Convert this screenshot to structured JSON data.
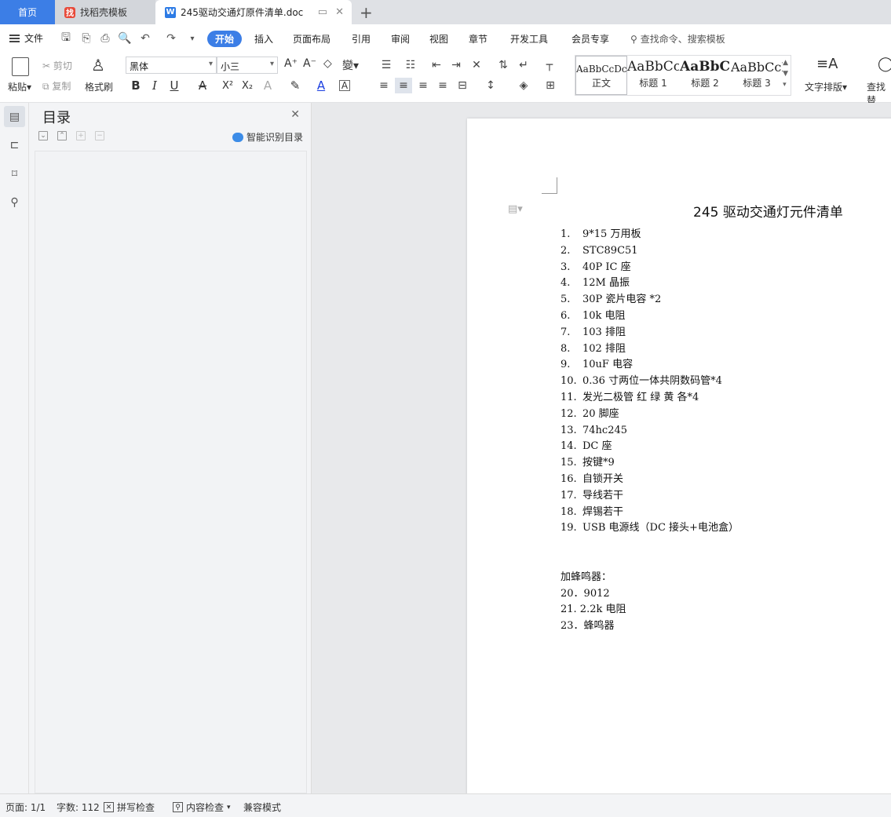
{
  "tabs": {
    "home": "首页",
    "templates": "找稻壳模板",
    "document": "245驱动交通灯原件清单.doc"
  },
  "menu": {
    "file": "文件",
    "items": [
      "开始",
      "插入",
      "页面布局",
      "引用",
      "审阅",
      "视图",
      "章节",
      "开发工具",
      "会员专享"
    ],
    "search_placeholder": "查找命令、搜索模板"
  },
  "ribbon": {
    "paste": "粘贴",
    "cut": "剪切",
    "copy": "复制",
    "format_painter": "格式刷",
    "font_name": "黑体",
    "font_size": "小三",
    "styles": [
      {
        "preview": "AaBbCcDc",
        "label": "正文"
      },
      {
        "preview": "AaBbCc",
        "label": "标题 1"
      },
      {
        "preview": "AaBbC",
        "label": "标题 2"
      },
      {
        "preview": "AaBbCcI",
        "label": "标题 3"
      }
    ],
    "text_layout": "文字排版",
    "find_replace": "查找替"
  },
  "toc": {
    "title": "目录",
    "smart_label": "智能识别目录"
  },
  "document": {
    "title": "245 驱动交通灯元件清单",
    "items": [
      {
        "num": "1.",
        "text": "9*15 万用板"
      },
      {
        "num": "2.",
        "text": "STC89C51"
      },
      {
        "num": "3.",
        "text": "40P IC 座"
      },
      {
        "num": "4.",
        "text": "12M 晶振"
      },
      {
        "num": "5.",
        "text": "30P 瓷片电容 *2"
      },
      {
        "num": "6.",
        "text": "10k 电阻"
      },
      {
        "num": "7.",
        "text": "103 排阻"
      },
      {
        "num": "8.",
        "text": "102 排阻"
      },
      {
        "num": "9.",
        "text": "10uF 电容"
      },
      {
        "num": "10.",
        "text": "0.36 寸两位一体共阴数码管*4"
      },
      {
        "num": "11.",
        "text": "发光二极管  红  绿  黄  各*4"
      },
      {
        "num": "12.",
        "text": "20 脚座"
      },
      {
        "num": "13.",
        "text": "74hc245"
      },
      {
        "num": "14.",
        "text": "DC 座"
      },
      {
        "num": "15.",
        "text": "按键*9"
      },
      {
        "num": "16.",
        "text": "自锁开关"
      },
      {
        "num": "17.",
        "text": "导线若干"
      },
      {
        "num": "18.",
        "text": "焊锡若干"
      },
      {
        "num": "19.",
        "text": "USB 电源线（DC 接头+电池盒）"
      }
    ],
    "extra_heading": "加蜂鸣器：",
    "extra_items": [
      "20．9012",
      "21. 2.2k 电阻",
      "23．蜂鸣器"
    ]
  },
  "status": {
    "page": "页面: 1/1",
    "words": "字数: 112",
    "spell_check": "拼写检查",
    "content_check": "内容检查",
    "compat_mode": "兼容模式"
  }
}
